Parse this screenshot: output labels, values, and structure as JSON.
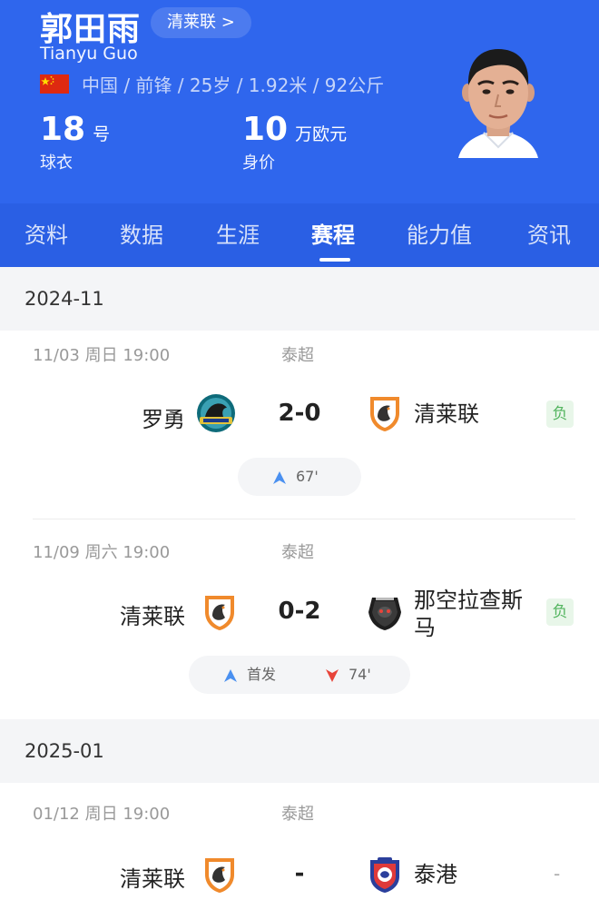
{
  "player": {
    "name": "郭田雨",
    "name_en": "Tianyu Guo",
    "club_link": "清莱联 >",
    "info": "中国 / 前锋 / 25岁 / 1.92米 / 92公斤",
    "flag_icon": "china-flag-icon",
    "jersey": {
      "value": "18",
      "unit": "号",
      "label": "球衣"
    },
    "market_value": {
      "value": "10",
      "unit": "万欧元",
      "label": "身价"
    }
  },
  "colors": {
    "brand_blue": "#2f66ed",
    "result_green": "#52b45e",
    "goal_blue": "#4a90f0",
    "sub_red": "#e8443a"
  },
  "tabs": [
    "资料",
    "数据",
    "生涯",
    "赛程",
    "能力值",
    "资讯"
  ],
  "active_tab": "赛程",
  "schedule": [
    {
      "month": "2024-11",
      "matches": [
        {
          "date": "11/03 周日 19:00",
          "league": "泰超",
          "home": "罗勇",
          "away": "清莱联",
          "score": "2-0",
          "result": "负",
          "events": [
            {
              "type": "sub-in",
              "text": "67'"
            }
          ]
        },
        {
          "date": "11/09 周六 19:00",
          "league": "泰超",
          "home": "清莱联",
          "away": "那空拉查斯马",
          "score": "0-2",
          "result": "负",
          "events": [
            {
              "type": "start",
              "text": "首发"
            },
            {
              "type": "sub-out",
              "text": "74'"
            }
          ]
        }
      ]
    },
    {
      "month": "2025-01",
      "matches": [
        {
          "date": "01/12 周日 19:00",
          "league": "泰超",
          "home": "清莱联",
          "away": "泰港",
          "score": "-",
          "result": "-"
        }
      ]
    }
  ]
}
